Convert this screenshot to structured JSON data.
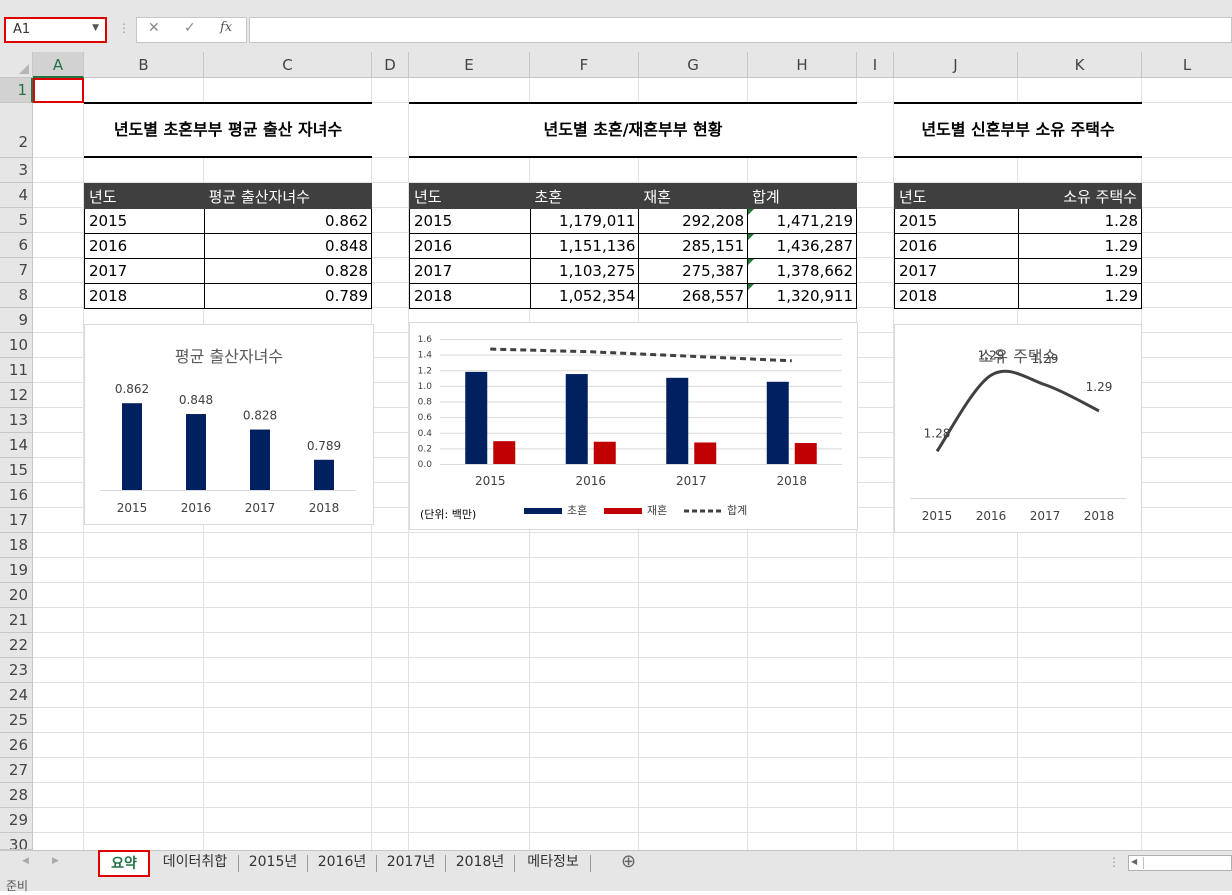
{
  "formula_bar": {
    "name_box": "A1",
    "cancel_icon": "✕",
    "enter_icon": "✓",
    "fx_icon": "fx",
    "formula": ""
  },
  "columns": [
    "A",
    "B",
    "C",
    "D",
    "E",
    "F",
    "G",
    "H",
    "I",
    "J",
    "K",
    "L"
  ],
  "rows": [
    "1",
    "2",
    "3",
    "4",
    "5",
    "6",
    "7",
    "8",
    "9",
    "10",
    "11",
    "12",
    "13",
    "14",
    "15",
    "16",
    "17",
    "18",
    "19",
    "20",
    "21",
    "22",
    "23",
    "24",
    "25",
    "26",
    "27",
    "28",
    "29",
    "30"
  ],
  "title1": "년도별 초혼부부 평균 출산 자녀수",
  "title2": "년도별 초혼/재혼부부 현황",
  "title3": "년도별 신혼부부 소유 주택수",
  "table1": {
    "headers": [
      "년도",
      "평균 출산자녀수"
    ],
    "rows": [
      [
        "2015",
        "0.862"
      ],
      [
        "2016",
        "0.848"
      ],
      [
        "2017",
        "0.828"
      ],
      [
        "2018",
        "0.789"
      ]
    ]
  },
  "table2": {
    "headers": [
      "년도",
      "초혼",
      "재혼",
      "합계"
    ],
    "rows": [
      [
        "2015",
        "1,179,011",
        "292,208",
        "1,471,219"
      ],
      [
        "2016",
        "1,151,136",
        "285,151",
        "1,436,287"
      ],
      [
        "2017",
        "1,103,275",
        "275,387",
        "1,378,662"
      ],
      [
        "2018",
        "1,052,354",
        "268,557",
        "1,320,911"
      ]
    ]
  },
  "table3": {
    "headers": [
      "년도",
      "소유 주택수"
    ],
    "rows": [
      [
        "2015",
        "1.28"
      ],
      [
        "2016",
        "1.29"
      ],
      [
        "2017",
        "1.29"
      ],
      [
        "2018",
        "1.29"
      ]
    ]
  },
  "chart1": {
    "title": "평균 출산자녀수"
  },
  "chart2": {
    "unit_note": "(단위: 백만)"
  },
  "chart3": {
    "title": "소유 주택수"
  },
  "chart_data": [
    {
      "type": "bar",
      "title": "평균 출산자녀수",
      "categories": [
        "2015",
        "2016",
        "2017",
        "2018"
      ],
      "values": [
        0.862,
        0.848,
        0.828,
        0.789
      ],
      "data_labels": [
        "0.862",
        "0.848",
        "0.828",
        "0.789"
      ],
      "color": "#002060",
      "ylim": [
        0.75,
        0.87
      ]
    },
    {
      "type": "bar",
      "categories": [
        "2015",
        "2016",
        "2017",
        "2018"
      ],
      "series": [
        {
          "name": "초혼",
          "values": [
            1.179011,
            1.151136,
            1.103275,
            1.052354
          ],
          "color": "#002060",
          "kind": "bar"
        },
        {
          "name": "재혼",
          "values": [
            0.292208,
            0.285151,
            0.275387,
            0.268557
          ],
          "color": "#c00000",
          "kind": "bar"
        },
        {
          "name": "합계",
          "values": [
            1.471219,
            1.436287,
            1.378662,
            1.320911
          ],
          "color": "#404040",
          "kind": "dashed-line"
        }
      ],
      "ylim": [
        0,
        1.6
      ],
      "yticks": [
        "0.0",
        "0.2",
        "0.4",
        "0.6",
        "0.8",
        "1.0",
        "1.2",
        "1.4",
        "1.6"
      ],
      "legend": "bottom",
      "grid": true
    },
    {
      "type": "line",
      "title": "소유 주택수",
      "categories": [
        "2015",
        "2016",
        "2017",
        "2018"
      ],
      "values": [
        1.28,
        1.29,
        1.29,
        1.29
      ],
      "data_labels": [
        "1.28",
        "1.29",
        "1.29",
        "1.29"
      ],
      "color": "#404040",
      "smooth": true
    }
  ],
  "sheet_tabs": [
    "요약",
    "데이터취합",
    "2015년",
    "2016년",
    "2017년",
    "2018년",
    "메타정보"
  ],
  "add_sheet_icon": "⊕",
  "status": "준비"
}
